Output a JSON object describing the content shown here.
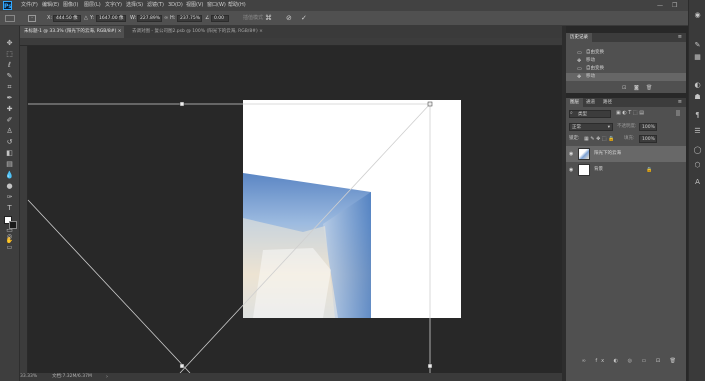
{
  "menubar": {
    "logo": "Ps",
    "items": [
      "文件(F)",
      "编辑(E)",
      "图像(I)",
      "图层(L)",
      "文字(Y)",
      "选择(S)",
      "滤镜(T)",
      "3D(D)",
      "视图(V)",
      "窗口(W)",
      "帮助(H)"
    ],
    "window_buttons": [
      "—",
      "❐",
      "✕"
    ]
  },
  "options": {
    "x_label": "X:",
    "x_value": "444.50 像",
    "y_label": "Y:",
    "y_value": "1647.00 像",
    "w_label": "W:",
    "w_value": "227.89%",
    "h_label": "H:",
    "h_value": "237.75%",
    "angle_value": "0.00",
    "interp_label": "插值模式",
    "cancel_icon": "cancel-icon",
    "commit_icon": "commit-icon"
  },
  "tabs": [
    {
      "label": "未标题-1 @ 33.3% (阳光下的云海, RGB/8#) ×"
    },
    {
      "label": "去调对图 - 复公司图2.psb @ 100% (阳光下的云海, RGB/8#) ×"
    }
  ],
  "tools": [
    "move-tool",
    "marquee-tool",
    "lasso-tool",
    "quick-select-tool",
    "crop-tool",
    "eyedropper-tool",
    "healing-tool",
    "brush-tool",
    "stamp-tool",
    "history-brush-tool",
    "eraser-tool",
    "gradient-tool",
    "blur-tool",
    "dodge-tool",
    "pen-tool",
    "type-tool",
    "path-select-tool",
    "shape-tool",
    "hand-tool",
    "zoom-tool",
    "more-tools"
  ],
  "status": {
    "zoom": "33.33%",
    "doc_info": "文档:7.32M/6.37M"
  },
  "history": {
    "tabs": [
      "历史记录"
    ],
    "items": [
      {
        "icon": "document-icon",
        "label": "自由变换"
      },
      {
        "icon": "move-icon",
        "label": "移动"
      },
      {
        "icon": "document-icon",
        "label": "自由变换"
      },
      {
        "icon": "move-icon",
        "label": "移动"
      }
    ]
  },
  "layers": {
    "tabs": [
      "图层",
      "通道",
      "路径"
    ],
    "kind_label": "类型",
    "blend_mode": "正常",
    "opacity_label": "不透明度:",
    "opacity_value": "100%",
    "lock_label": "锁定:",
    "fill_label": "填充:",
    "fill_value": "100%",
    "items": [
      {
        "name": "阳光下的云海",
        "selected": true
      },
      {
        "name": "背景",
        "selected": false,
        "locked": true
      }
    ]
  },
  "right_icons": [
    "eye-icon",
    "brush-panel-icon",
    "swatch-icon",
    "adjust-icon",
    "style-icon",
    "paragraph-icon",
    "character-icon",
    "circle-icon",
    "cube-icon",
    "glyph-icon"
  ],
  "colors": {
    "accent": "#31a8ff",
    "page": "#ffffff",
    "bg": "#282828"
  }
}
